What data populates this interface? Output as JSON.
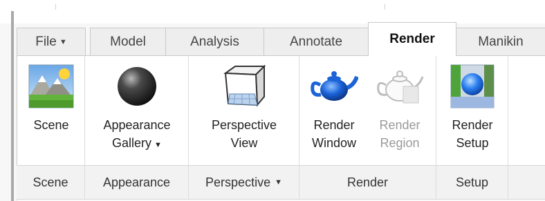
{
  "tabs": [
    {
      "id": "file",
      "label": "File"
    },
    {
      "id": "model",
      "label": "Model"
    },
    {
      "id": "analysis",
      "label": "Analysis"
    },
    {
      "id": "annotate",
      "label": "Annotate"
    },
    {
      "id": "render",
      "label": "Render"
    },
    {
      "id": "manikin",
      "label": "Manikin"
    }
  ],
  "active_tab": "Render",
  "buttons": {
    "scene": {
      "label": "Scene",
      "icon": "scene-icon"
    },
    "appearance_gallery": {
      "label": "Appearance\nGallery",
      "icon": "sphere-icon"
    },
    "perspective_view": {
      "label": "Perspective\nView",
      "icon": "cube-icon"
    },
    "render_window": {
      "label": "Render\nWindow",
      "icon": "teapot-icon"
    },
    "render_region": {
      "label": "Render\nRegion",
      "icon": "teapot-outline-icon",
      "disabled": true
    },
    "render_setup": {
      "label": "Render\nSetup",
      "icon": "render-setup-icon"
    }
  },
  "groups": {
    "scene": "Scene",
    "appearance": "Appearance",
    "perspective": "Perspective",
    "render": "Render",
    "setup": "Setup"
  },
  "colors": {
    "accent_blue": "#1a63d8",
    "disabled_text": "#9a9a9a"
  },
  "dropdown_arrow": "▼"
}
